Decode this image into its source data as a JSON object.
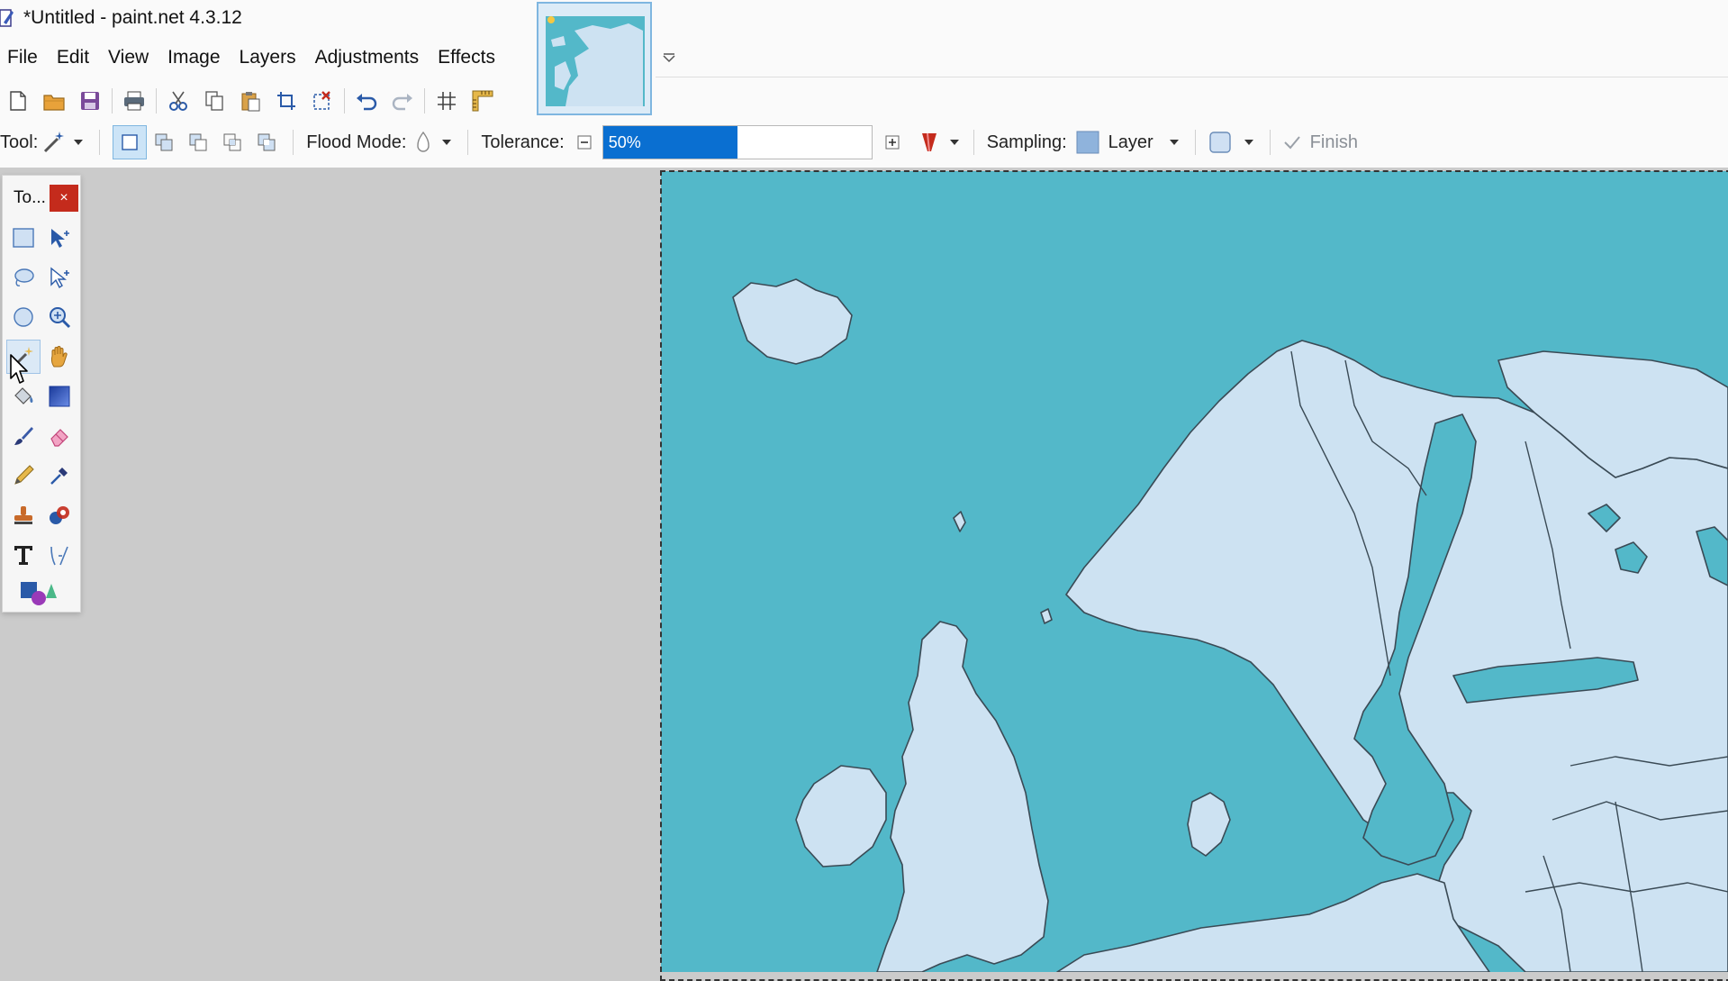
{
  "window": {
    "title": "*Untitled - paint.net 4.3.12"
  },
  "menu": [
    "File",
    "Edit",
    "View",
    "Image",
    "Layers",
    "Adjustments",
    "Effects"
  ],
  "toolbar1": [
    "new-file-icon",
    "open-folder-icon",
    "save-icon",
    "print-icon",
    "cut-icon",
    "copy-icon",
    "paste-icon",
    "crop-icon",
    "deselect-icon",
    "undo-icon",
    "redo-icon",
    "grid-icon",
    "ruler-icon"
  ],
  "toolbar2": {
    "tool_label": "Tool:",
    "flood_mode_label": "Flood Mode:",
    "tolerance_label": "Tolerance:",
    "tolerance_value": "50%",
    "tolerance_fraction": 0.5,
    "sampling_label": "Sampling:",
    "sampling_value": "Layer",
    "finish_label": "Finish"
  },
  "tools_window": {
    "title": "To...",
    "close": "×",
    "tools": [
      "rectangle-select-icon",
      "move-selection-icon",
      "lasso-select-icon",
      "move-selected-icon",
      "ellipse-select-icon",
      "zoom-icon",
      "magic-wand-icon",
      "pan-icon",
      "paint-bucket-icon",
      "gradient-icon",
      "paintbrush-icon",
      "eraser-icon",
      "pencil-icon",
      "color-picker-icon",
      "clone-stamp-icon",
      "recolor-icon",
      "text-icon",
      "line-curve-icon",
      "shapes-icon"
    ]
  },
  "colors": {
    "sea": "#53b8c9",
    "land": "#cde2f2",
    "border": "#3a4a55",
    "accent": "#0a6fd1",
    "close": "#c42b1c"
  }
}
